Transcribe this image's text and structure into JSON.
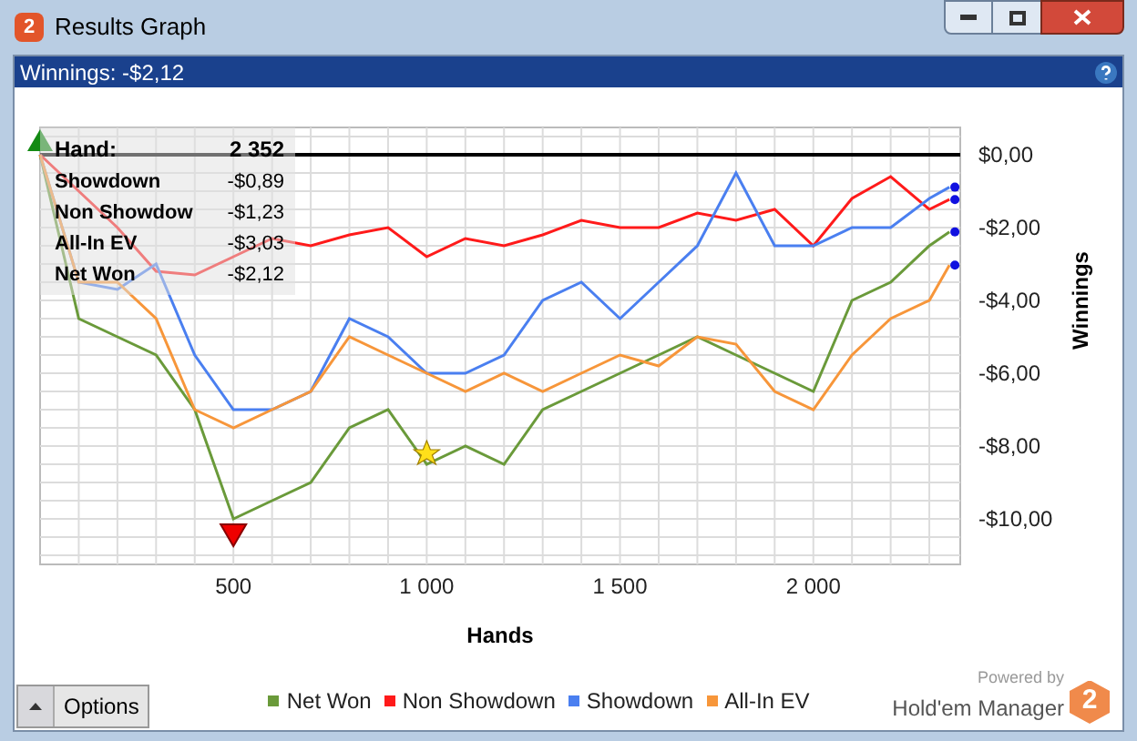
{
  "window": {
    "title": "Results Graph"
  },
  "header": {
    "winnings": "Winnings: -$2,12"
  },
  "tooltip": {
    "rows": [
      {
        "label": "Hand:",
        "value": "2 352"
      },
      {
        "label": "Showdown",
        "value": "-$0,89"
      },
      {
        "label": "Non Showdow",
        "value": "-$1,23"
      },
      {
        "label": "All-In EV",
        "value": "-$3,03"
      },
      {
        "label": "Net Won",
        "value": "-$2,12"
      }
    ]
  },
  "chart_data": {
    "type": "line",
    "xlabel": "Hands",
    "ylabel": "Winnings",
    "x": [
      0,
      100,
      200,
      300,
      400,
      500,
      600,
      700,
      800,
      900,
      1000,
      1100,
      1200,
      1300,
      1400,
      1500,
      1600,
      1700,
      1800,
      1900,
      2000,
      2100,
      2200,
      2300,
      2352
    ],
    "series": [
      {
        "name": "Net Won",
        "color": "#6a9a3a",
        "values": [
          0,
          -4.5,
          -5,
          -5.5,
          -7,
          -10,
          -9.5,
          -9,
          -7.5,
          -7,
          -8.5,
          -8,
          -8.5,
          -7,
          -6.5,
          -6,
          -5.5,
          -5,
          -5.5,
          -6,
          -6.5,
          -4,
          -3.5,
          -2.5,
          -2.12
        ]
      },
      {
        "name": "Non Showdown",
        "color": "#ff1a1a",
        "values": [
          0,
          -1,
          -2,
          -3.2,
          -3.3,
          -2.8,
          -2.3,
          -2.5,
          -2.2,
          -2,
          -2.8,
          -2.3,
          -2.5,
          -2.2,
          -1.8,
          -2,
          -2,
          -1.6,
          -1.8,
          -1.5,
          -2.5,
          -1.2,
          -0.6,
          -1.5,
          -1.23
        ]
      },
      {
        "name": "Showdown",
        "color": "#4a7ff0",
        "values": [
          0,
          -3.5,
          -3.7,
          -3,
          -5.5,
          -7,
          -7,
          -6.5,
          -4.5,
          -5,
          -6,
          -6,
          -5.5,
          -4,
          -3.5,
          -4.5,
          -3.5,
          -2.5,
          -0.5,
          -2.5,
          -2.5,
          -2,
          -2,
          -1.2,
          -0.89
        ]
      },
      {
        "name": "All-In EV",
        "color": "#f7963a",
        "values": [
          0,
          -3.5,
          -3.5,
          -4.5,
          -7,
          -7.5,
          -7,
          -6.5,
          -5,
          -5.5,
          -6,
          -6.5,
          -6,
          -6.5,
          -6,
          -5.5,
          -5.8,
          -5,
          -5.2,
          -6.5,
          -7,
          -5.5,
          -4.5,
          -4,
          -3.03
        ]
      }
    ],
    "grid": true,
    "xlim": [
      0,
      2380
    ],
    "ylim": [
      -11.25,
      0.75
    ],
    "xticks": [
      {
        "value": 500,
        "label": "500"
      },
      {
        "value": 1000,
        "label": "1 000"
      },
      {
        "value": 1500,
        "label": "1 500"
      },
      {
        "value": 2000,
        "label": "2 000"
      }
    ],
    "yticks": [
      {
        "value": 0,
        "label": "$0,00"
      },
      {
        "value": -2,
        "label": "-$2,00"
      },
      {
        "value": -4,
        "label": "-$4,00"
      },
      {
        "value": -6,
        "label": "-$6,00"
      },
      {
        "value": -8,
        "label": "-$8,00"
      },
      {
        "value": -10,
        "label": "-$10,00"
      }
    ]
  },
  "footer": {
    "options_button": "Options",
    "powered_by": "Powered by",
    "brand": "Hold'em Manager",
    "logo_digit": "2"
  },
  "title_logo": "2"
}
